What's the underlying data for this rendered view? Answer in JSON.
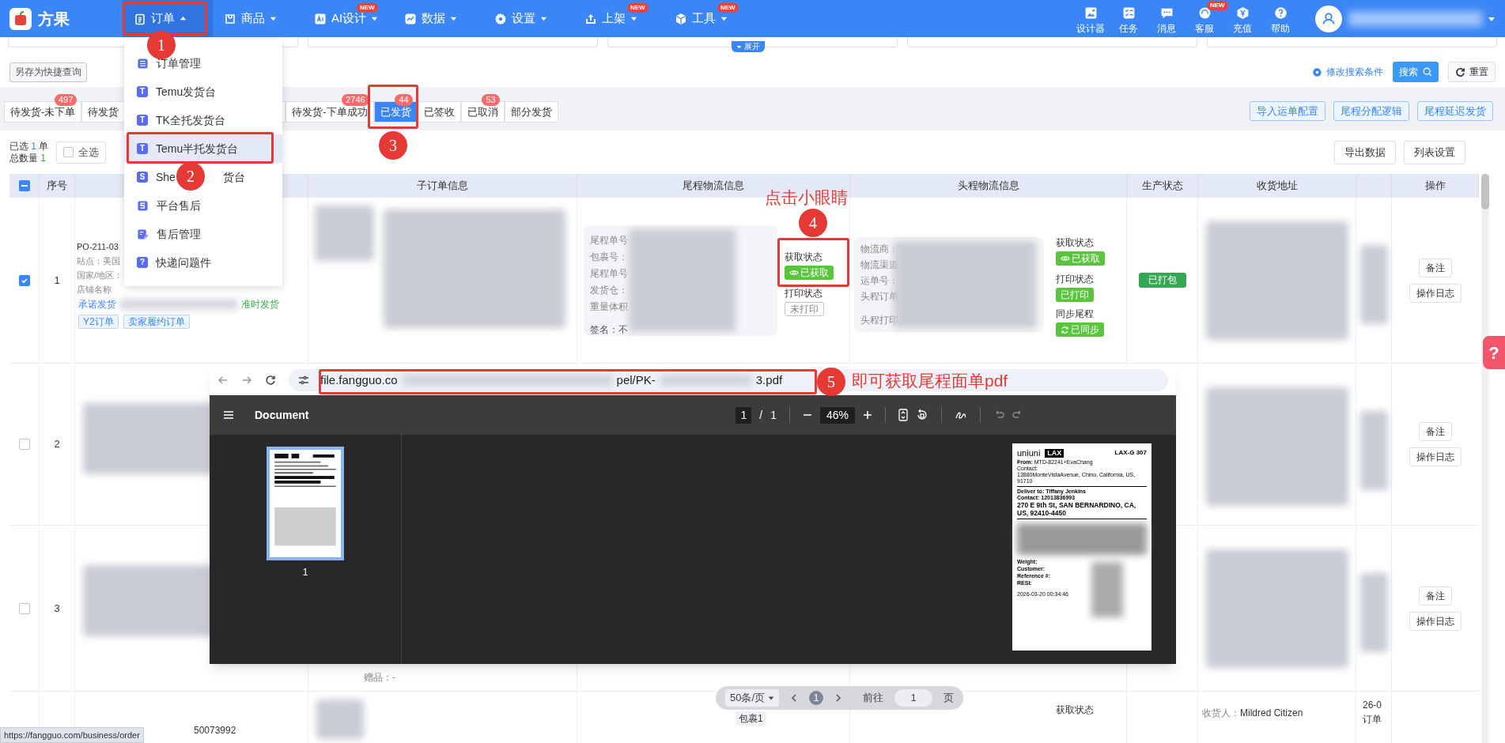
{
  "nav": {
    "logo": "方果",
    "items": [
      {
        "label": "订单",
        "selected": true
      },
      {
        "label": "商品",
        "selected": false
      },
      {
        "label": "AI设计",
        "selected": false,
        "badge": "NEW"
      },
      {
        "label": "数据",
        "selected": false
      },
      {
        "label": "设置",
        "selected": false
      },
      {
        "label": "上架",
        "selected": false,
        "badge": "NEW"
      },
      {
        "label": "工具",
        "selected": false,
        "badge": "NEW"
      }
    ],
    "tools": [
      {
        "label": "设计器"
      },
      {
        "label": "任务"
      },
      {
        "label": "消息"
      },
      {
        "label": "客服",
        "badge": "NEW"
      },
      {
        "label": "充值"
      },
      {
        "label": "帮助"
      }
    ]
  },
  "menu": {
    "items": [
      {
        "label": "订单管理",
        "selected": false
      },
      {
        "label": "Temu发货台",
        "letter": "T",
        "selected": false
      },
      {
        "label": "TK全托发货台",
        "letter": "T",
        "selected": false
      },
      {
        "label": "Temu半托发货台",
        "letter": "T",
        "selected": true
      },
      {
        "label": "She",
        "label_tail": "货台",
        "letter": "S",
        "selected": false
      },
      {
        "label": "平台售后",
        "selected": false
      },
      {
        "label": "售后管理",
        "selected": false
      },
      {
        "label": "快递问题件",
        "letter": "?",
        "selected": false
      }
    ]
  },
  "filter": {
    "save_query": "另存为快捷查询",
    "expand": "展开",
    "edit_conditions": "修改搜索条件",
    "search": "搜索",
    "reset": "重置"
  },
  "tabs": [
    {
      "label": "待发货-未下单",
      "count": "497",
      "selected": false
    },
    {
      "label": "待发货",
      "selected": false
    },
    {
      "label": "待发货-下单成功",
      "count": "2746",
      "selected": false
    },
    {
      "label": "已发货",
      "count": "44",
      "selected": true
    },
    {
      "label": "已签收",
      "selected": false
    },
    {
      "label": "已取消",
      "count": "53",
      "selected": false
    },
    {
      "label": "部分发货",
      "selected": false
    }
  ],
  "tab_actions": [
    "导入运单配置",
    "尾程分配逻辑",
    "尾程延迟发货"
  ],
  "toolbar": {
    "selected_label": "已选",
    "selected_count": "1",
    "selected_unit": "单",
    "total_label": "总数量",
    "total_count": "1",
    "select_all": {
      "label": "全选",
      "checked": false
    },
    "buttons": [
      "导出数据",
      "列表设置"
    ]
  },
  "table": {
    "header_checkbox": {
      "partial": true
    },
    "columns": [
      {
        "label": "序号"
      },
      {
        "label": "子订单信息"
      },
      {
        "label": "尾程物流信息"
      },
      {
        "label": "头程物流信息"
      },
      {
        "label": "生产状态"
      },
      {
        "label": "收货地址"
      },
      {
        "label": "操作"
      }
    ],
    "rows": [
      {
        "checked": true,
        "index": "1",
        "order_lines": [
          "PO-211-03",
          "站点：美国",
          "国家/地区：",
          "店铺名称"
        ],
        "promise": "承诺发货",
        "ontime": "准时发货",
        "tags": [
          "Y2订单",
          "卖家履约订单"
        ],
        "tail": {
          "labels": [
            "尾程单号",
            "包裹号：",
            "尾程单号",
            "发货仓：",
            "重量体积"
          ],
          "sign": "签名：不",
          "statuses": [
            {
              "label": "获取状态",
              "text": "已获取",
              "done": true,
              "kind": "eye"
            },
            {
              "label": "打印状态",
              "text": "未打印",
              "done": false,
              "kind": "plain"
            }
          ]
        },
        "head": {
          "labels": [
            "物流商：",
            "物流渠道",
            "运单号：",
            "头程订单"
          ],
          "print_label": "头程打印",
          "statuses": [
            {
              "label": "获取状态",
              "text": "已获取",
              "done": true,
              "kind": "eye"
            },
            {
              "label": "打印状态",
              "text": "已打印",
              "done": true,
              "kind": "plain"
            },
            {
              "label": "同步尾程",
              "text": "已同步",
              "done": true,
              "kind": "sync"
            }
          ]
        },
        "production": "已打包",
        "ops": [
          "备注",
          "操作日志"
        ]
      },
      {
        "checked": false,
        "index": "2",
        "ops": [
          "备注",
          "操作日志"
        ]
      },
      {
        "checked": false,
        "index": "3",
        "ops": [
          "备注",
          "操作日志"
        ],
        "gift": "赠品：-"
      }
    ],
    "partial_row": {
      "order_no": "50073992",
      "package": "包裹1",
      "status_label": "获取状态",
      "consignee_label": "收货人：",
      "consignee": "Mildred Citizen",
      "column_9": [
        "26-0",
        "订单"
      ]
    }
  },
  "pdf_viewer": {
    "url_parts": [
      "file.fangguo.co",
      "pel/PK-",
      "3.pdf"
    ],
    "title": "Document",
    "page": "1",
    "page_sep": "/",
    "pages": "1",
    "zoom": "46%",
    "thumbnail_label": "1",
    "label": {
      "brand": "uniuni",
      "hub": "LAX",
      "route": "LAX-G 307",
      "from": "**From:** MTD-82241+EvaChang",
      "contact": "Contact:",
      "from_address": "13880MonteVistaAvenue, Chino, California, US, 91710",
      "deliver": "Deliver to: Tiffany Jenkins",
      "contact2": "Contact: 12013836993",
      "address": "270 E 9th St, SAN BERNARDINO, CA, US, 92410-4450",
      "fields": [
        "Weight:",
        "Customer:",
        "Reference #:",
        "RESI:"
      ],
      "timestamp": "2026-03-20 00:34:46"
    }
  },
  "pagination": {
    "page_size": "50条/页",
    "current": "1",
    "goto_label": "前往",
    "goto_value": "1",
    "goto_unit": "页"
  },
  "status_link": "https://fangguo.com/business/order",
  "help": "?",
  "annotations": {
    "markers": [
      "1",
      "2",
      "3",
      "4",
      "5"
    ],
    "notes": [
      "点击小眼睛",
      "即可获取尾程面单pdf"
    ]
  }
}
